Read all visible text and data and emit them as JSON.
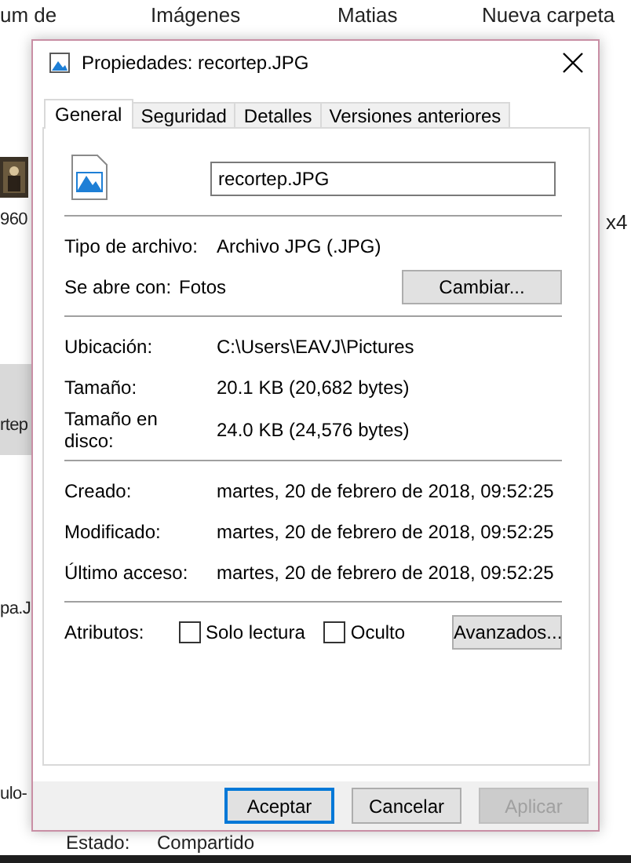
{
  "explorer": {
    "top_items": [
      "um de",
      "Imágenes",
      "Matias",
      "Nueva carpeta"
    ],
    "left_items": [
      "960",
      "rtep",
      "pa.J",
      "ulo-"
    ],
    "right_items": [
      "x4"
    ],
    "status": {
      "label": "Estado:",
      "value": "Compartido"
    }
  },
  "dialog": {
    "title": "Propiedades: recortep.JPG",
    "tabs": [
      {
        "label": "General",
        "selected": true
      },
      {
        "label": "Seguridad",
        "selected": false
      },
      {
        "label": "Detalles",
        "selected": false
      },
      {
        "label": "Versiones anteriores",
        "selected": false
      }
    ],
    "file_name": "recortep.JPG",
    "sections": [
      {
        "rows": [
          {
            "kind": "text",
            "label": "Tipo de archivo:",
            "value": "Archivo JPG (.JPG)"
          },
          {
            "kind": "app",
            "label": "Se abre con:",
            "value": "Fotos",
            "button": "Cambiar..."
          }
        ]
      },
      {
        "rows": [
          {
            "kind": "text",
            "label": "Ubicación:",
            "value": "C:\\Users\\EAVJ\\Pictures"
          },
          {
            "kind": "text",
            "label": "Tamaño:",
            "value": "20.1 KB (20,682 bytes)"
          },
          {
            "kind": "text",
            "label": "Tamaño en\ndisco:",
            "value": "24.0 KB (24,576 bytes)"
          }
        ]
      },
      {
        "rows": [
          {
            "kind": "text",
            "label": "Creado:",
            "value": "martes, 20 de febrero de 2018, 09:52:25"
          },
          {
            "kind": "text",
            "label": "Modificado:",
            "value": "martes, 20 de febrero de 2018, 09:52:25"
          },
          {
            "kind": "text",
            "label": "Último acceso:",
            "value": "martes, 20 de febrero de 2018, 09:52:25"
          }
        ]
      },
      {
        "rows": [
          {
            "kind": "attributes",
            "label": "Atributos:",
            "checks": [
              {
                "label": "Solo lectura",
                "checked": false
              },
              {
                "label": "Oculto",
                "checked": false
              }
            ],
            "button": "Avanzados..."
          }
        ]
      }
    ],
    "buttons": [
      {
        "label": "Aceptar",
        "default": true,
        "disabled": false
      },
      {
        "label": "Cancelar",
        "default": false,
        "disabled": false
      },
      {
        "label": "Aplicar",
        "default": false,
        "disabled": true
      }
    ]
  }
}
